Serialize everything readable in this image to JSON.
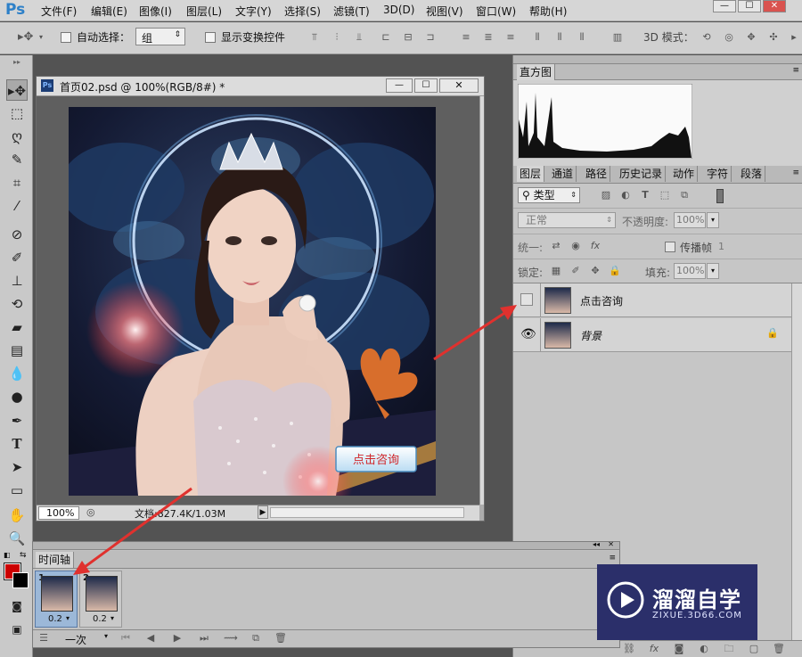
{
  "app": {
    "logo": "Ps"
  },
  "menu": [
    "文件(F)",
    "编辑(E)",
    "图像(I)",
    "图层(L)",
    "文字(Y)",
    "选择(S)",
    "滤镜(T)",
    "3D(D)",
    "视图(V)",
    "窗口(W)",
    "帮助(H)"
  ],
  "window_controls": {
    "minimize": "—",
    "maximize": "☐",
    "close": "✕"
  },
  "options_bar": {
    "auto_select_label": "自动选择：",
    "auto_select_value": "组",
    "show_transform_label": "显示变换控件",
    "mode_3d_label": "3D 模式："
  },
  "document": {
    "title": "首页02.psd @ 100%(RGB/8#) *",
    "zoom": "100%",
    "doc_info": "文档:827.4K/1.03M",
    "button_text": "点击咨询"
  },
  "histogram": {
    "tab": "直方图"
  },
  "panel_tabs": [
    "图层",
    "通道",
    "路径",
    "历史记录",
    "动作",
    "字符",
    "段落"
  ],
  "layers_panel": {
    "filter_kind": "类型",
    "blend_mode": "正常",
    "opacity_label": "不透明度:",
    "opacity_value": "100%",
    "unify_label": "统一:",
    "propagate_label": "传播帧",
    "propagate_value": "1",
    "lock_label": "锁定:",
    "fill_label": "填充:",
    "fill_value": "100%",
    "layers": [
      {
        "name": "点击咨询",
        "visible": false
      },
      {
        "name": "背景",
        "visible": true,
        "locked": true
      }
    ]
  },
  "timeline": {
    "tab": "时间轴",
    "frames": [
      {
        "number": "1",
        "delay": "0.2"
      },
      {
        "number": "2",
        "delay": "0.2"
      }
    ],
    "loop": "一次"
  },
  "watermark": {
    "name": "溜溜自学",
    "url": "ZIXUE.3D66.COM"
  },
  "colors": {
    "accent_red": "#e0312e",
    "ps_blue": "#2d80c8",
    "foreground": "#cc0000",
    "background": "#000000"
  }
}
